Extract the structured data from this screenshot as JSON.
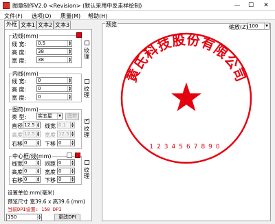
{
  "window": {
    "title": "图章制作V2.0 <Revision> (默认采用中反走样绘制)",
    "min": "—",
    "max": "☐",
    "close": "✕"
  },
  "menu": {
    "file": "文件(F)",
    "options": "选项(O)",
    "quality": "质量(M)",
    "help": "帮助(H)"
  },
  "tabs": [
    "外框",
    "文本1",
    "文本2",
    "文本3"
  ],
  "outer": {
    "legend": "边线(mm)",
    "line_width_label": "线 宽:",
    "line_width": "0.5",
    "height_label": "高 度:",
    "height": "38",
    "width_label": "宽 度:",
    "width": "38",
    "texture": "纹理",
    "color": "#e5000e"
  },
  "inner": {
    "legend": "内线(mm)",
    "line_width_label": "线 宽:",
    "line_width": "0",
    "height_label": "高 度:",
    "height": "0",
    "width_label": "宽 度:",
    "width": "0",
    "texture": "纹理"
  },
  "symbol": {
    "legend": "图符(mm)",
    "type_label": "类 型:",
    "type_value": "实五星",
    "symbol_button": "图符",
    "diameter_label": "直径",
    "diameter": "12.5",
    "lw_label": "线宽",
    "lw": "0.1",
    "height_label": "高度",
    "height": "12.5",
    "width_label": "宽度",
    "width": "12.5",
    "shift_label": "右移",
    "shift": "0",
    "down_label": "下移",
    "down": "0",
    "texture": "纹理"
  },
  "center": {
    "legend": "中心框/线(mm)",
    "lw_label": "线宽",
    "lw": "0",
    "gap_label": "间距",
    "gap": "0",
    "height_label": "高度",
    "height": "0",
    "width_label": "宽度",
    "width": "0",
    "shift_label": "右移",
    "shift": "0",
    "down_label": "下移",
    "down": "0",
    "texture": "纹理"
  },
  "info": {
    "unit": "设置单位:mm(毫米)",
    "preview_size": "预览尺寸 宽39.6 x 高39.6 (mm)",
    "dpi": "当前DPI设置: 150 DPI",
    "dpi_value": "150",
    "change_dpi": "更改DPI"
  },
  "preview": {
    "legend": "预览",
    "zoom_label": "缩放(Z)",
    "zoom_value": "100",
    "arc_text": "黄氏科技股份有限公司",
    "number": "1234567890",
    "stamp_color": "#e5000e"
  }
}
